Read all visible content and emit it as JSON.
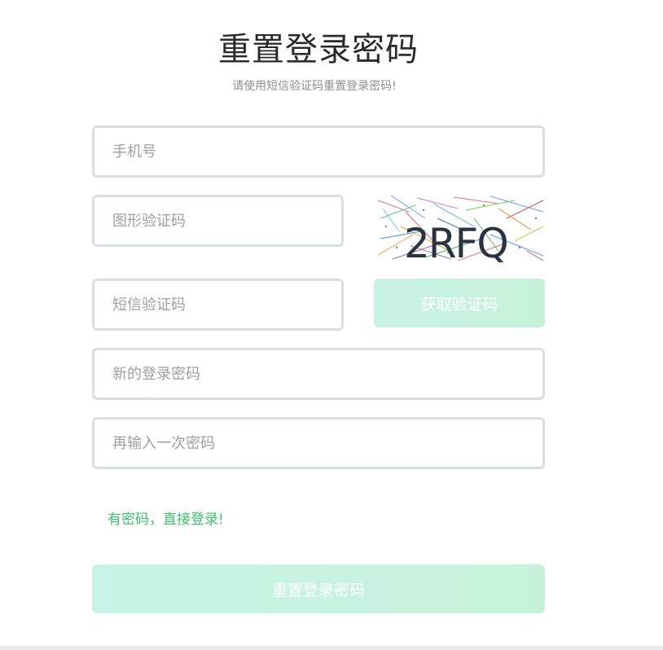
{
  "header": {
    "title": "重置登录密码",
    "subtitle": "请使用短信验证码重置登录密码!"
  },
  "form": {
    "phone": {
      "placeholder": "手机号",
      "value": ""
    },
    "captcha": {
      "placeholder": "图形验证码",
      "value": ""
    },
    "captcha_image": {
      "text": "2RFQ"
    },
    "sms_code": {
      "placeholder": "短信验证码",
      "value": ""
    },
    "get_code_button": "获取验证码",
    "new_password": {
      "placeholder": "新的登录密码",
      "value": ""
    },
    "confirm_password": {
      "placeholder": "再输入一次密码",
      "value": ""
    },
    "login_link": "有密码，直接登录!",
    "submit_button": "重置登录密码"
  },
  "colors": {
    "title": "#2b2b2b",
    "subtitle": "#8a9096",
    "input_border": "#dadee4",
    "button_gradient_start": "#c9f2e6",
    "button_gradient_end": "#c7f2d9",
    "link": "#3bbf6b"
  }
}
